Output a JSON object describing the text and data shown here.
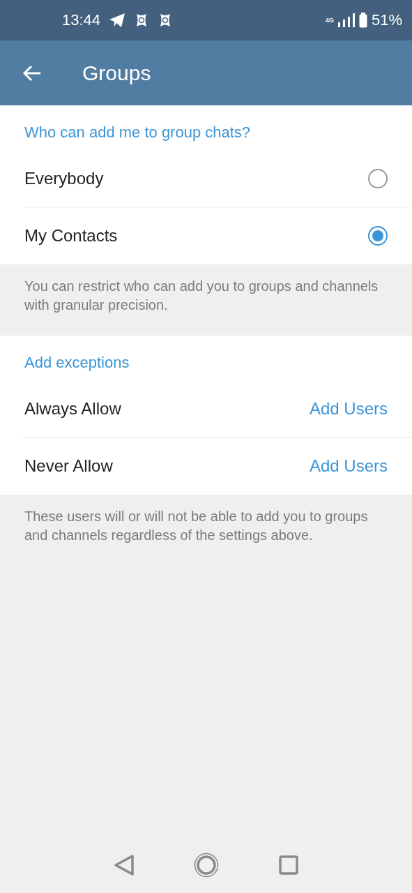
{
  "status_bar": {
    "time": "13:44",
    "network": "4G",
    "battery": "51%"
  },
  "app_bar": {
    "title": "Groups"
  },
  "privacy": {
    "header": "Who can add me to group chats?",
    "options": [
      {
        "label": "Everybody",
        "selected": false
      },
      {
        "label": "My Contacts",
        "selected": true
      }
    ],
    "note": "You can restrict who can add you to groups and channels with granular precision."
  },
  "exceptions": {
    "header": "Add exceptions",
    "rows": [
      {
        "label": "Always Allow",
        "action": "Add Users"
      },
      {
        "label": "Never Allow",
        "action": "Add Users"
      }
    ],
    "note": "These users will or will not be able to add you to groups and channels regardless of the settings above."
  }
}
